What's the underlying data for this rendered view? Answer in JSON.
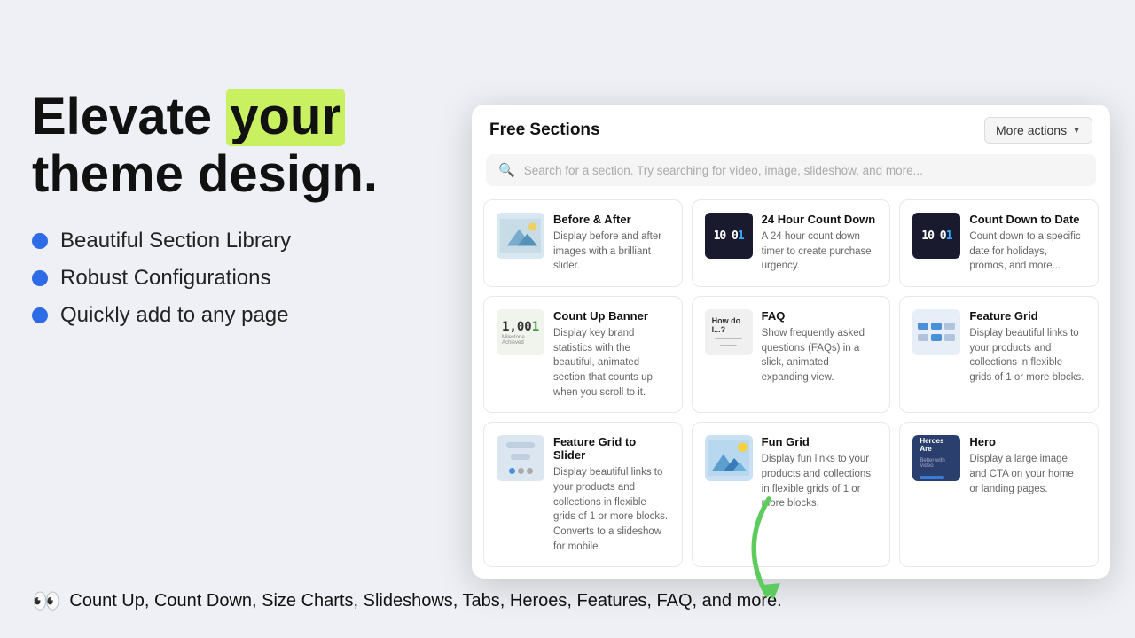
{
  "page": {
    "bg_color": "#eef0f5"
  },
  "left": {
    "headline_part1": "Elevate ",
    "headline_highlight": "your",
    "headline_part2": "theme design.",
    "bullets": [
      "Beautiful Section Library",
      "Robust Configurations",
      "Quickly add to any page"
    ],
    "tagline": "Count Up, Count Down, Size Charts, Slideshows, Tabs, Heroes, Features, FAQ, and more."
  },
  "modal": {
    "title": "Free Sections",
    "more_actions_label": "More actions",
    "search_placeholder": "Search for a section. Try searching for video, image, slideshow, and more...",
    "cards": [
      {
        "id": "before-after",
        "title": "Before & After",
        "desc": "Display before and after images with a brilliant slider.",
        "thumb_type": "mountains"
      },
      {
        "id": "24-hour-countdown",
        "title": "24 Hour Count Down",
        "desc": "A 24 hour count down timer to create purchase urgency.",
        "thumb_type": "countdown"
      },
      {
        "id": "count-down-to-date",
        "title": "Count Down to Date",
        "desc": "Count down to a specific date for holidays, promos, and more...",
        "thumb_type": "countdown2"
      },
      {
        "id": "count-up-banner",
        "title": "Count Up Banner",
        "desc": "Display key brand statistics with the beautiful, animated section that counts up when you scroll to it.",
        "thumb_type": "countup"
      },
      {
        "id": "faq",
        "title": "FAQ",
        "desc": "Show frequently asked questions (FAQs) in a slick, animated expanding view.",
        "thumb_type": "faq"
      },
      {
        "id": "feature-grid",
        "title": "Feature Grid",
        "desc": "Display beautiful links to your products and collections in flexible grids of 1 or more blocks.",
        "thumb_type": "feature-grid"
      },
      {
        "id": "feature-grid-slider",
        "title": "Feature Grid to Slider",
        "desc": "Display beautiful links to your products and collections in flexible grids of 1 or more blocks. Converts to a slideshow for mobile.",
        "thumb_type": "slider"
      },
      {
        "id": "fun-grid",
        "title": "Fun Grid",
        "desc": "Display fun links to your products and collections in flexible grids of 1 or more blocks.",
        "thumb_type": "fun-grid"
      },
      {
        "id": "hero",
        "title": "Hero",
        "desc": "Display a large image and CTA on your home or landing pages.",
        "thumb_type": "hero"
      }
    ]
  }
}
